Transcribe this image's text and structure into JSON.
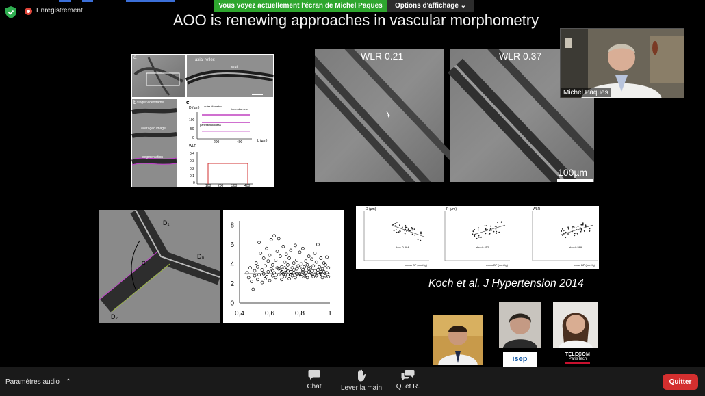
{
  "meeting": {
    "recording_label": "Enregistrement",
    "share_banner": "Vous voyez actuellement l'écran de Michel Paques",
    "view_options": "Options d'affichage",
    "quit_label": "Quitter",
    "audio_settings_label": "Paramètres audio",
    "toolbar": [
      {
        "label": "Chat",
        "icon": "chat-icon"
      },
      {
        "label": "Lever la main",
        "icon": "raise-hand-icon"
      },
      {
        "label": "Q. et R.",
        "icon": "qa-icon"
      }
    ],
    "participant_name": "Michel Paques",
    "colors": {
      "banner": "#2ea62e",
      "quit": "#d42f2f",
      "shield": "#2fae50",
      "record": "#e0453a"
    }
  },
  "slide": {
    "title": "AOO is renewing approaches in vascular morphometry",
    "wlr_left": "WLR 0.21",
    "wlr_right": "WLR 0.37",
    "scale_bar": "100µm",
    "citation": "Koch et al. J Hypertension 2014",
    "fig_a": {
      "panel_a": "a",
      "panel_b": "b",
      "panel_c": "c",
      "axial_reflex": "axial reflex",
      "wall": "wall",
      "single_videoframe": "single videoframe",
      "averaged_image": "averaged image",
      "segmentation": "segmentation",
      "d_axis": "D (µm)",
      "outer_diameter": "outer diameter",
      "inner_diameter": "inner diameter",
      "parietal_thickness": "parietal thickness",
      "l_axis": "L (µm)",
      "wlr_axis": "WLR",
      "y_ticks_top": [
        "100",
        "50",
        "0"
      ],
      "x_ticks_top": [
        "200",
        "400"
      ],
      "y_ticks_bottom": [
        "0.4",
        "0.3",
        "0.2",
        "0.1",
        "0"
      ],
      "x_ticks_bottom": [
        "100",
        "200",
        "300",
        "400"
      ]
    },
    "bifurcation": {
      "d1": "D₁",
      "d0": "D₀",
      "d2": "D₂",
      "alpha": "α"
    },
    "koch_panels": [
      {
        "ylabel": "D (µm)",
        "rho": "rho=-0.384",
        "xlabel": "mean BP (mmHg)"
      },
      {
        "ylabel": "P (µm)",
        "rho": "rho=0.452",
        "xlabel": "mean BP (mmHg)"
      },
      {
        "ylabel": "WLR",
        "rho": "rho=0.589",
        "xlabel": "mean BP (mmHg)"
      }
    ],
    "logos": {
      "isep": "isep",
      "telecom_top": "TELECOM",
      "telecom_bottom": "ParisTech"
    }
  },
  "chart_data": {
    "type": "scatter",
    "title": "",
    "xlabel": "",
    "ylabel": "",
    "xlim": [
      0.4,
      1
    ],
    "ylim": [
      0,
      8
    ],
    "x_ticks": [
      "0,4",
      "0,6",
      "0,8",
      "1"
    ],
    "y_ticks": [
      "0",
      "2",
      "4",
      "6",
      "8"
    ],
    "reference_line_y": 3,
    "points": [
      [
        0.45,
        3.1
      ],
      [
        0.46,
        2.6
      ],
      [
        0.47,
        3.6
      ],
      [
        0.48,
        2.2
      ],
      [
        0.49,
        1.4
      ],
      [
        0.5,
        3.3
      ],
      [
        0.5,
        2.8
      ],
      [
        0.51,
        4.1
      ],
      [
        0.52,
        2.4
      ],
      [
        0.52,
        3.7
      ],
      [
        0.53,
        6.2
      ],
      [
        0.53,
        2.9
      ],
      [
        0.54,
        5.1
      ],
      [
        0.55,
        3.4
      ],
      [
        0.55,
        2.1
      ],
      [
        0.56,
        4.6
      ],
      [
        0.56,
        3.0
      ],
      [
        0.57,
        2.5
      ],
      [
        0.57,
        3.8
      ],
      [
        0.58,
        5.6
      ],
      [
        0.58,
        2.7
      ],
      [
        0.59,
        4.3
      ],
      [
        0.59,
        3.2
      ],
      [
        0.6,
        2.3
      ],
      [
        0.6,
        4.9
      ],
      [
        0.61,
        3.5
      ],
      [
        0.61,
        6.5
      ],
      [
        0.62,
        2.8
      ],
      [
        0.62,
        3.9
      ],
      [
        0.63,
        6.9
      ],
      [
        0.63,
        3.1
      ],
      [
        0.64,
        4.4
      ],
      [
        0.64,
        2.6
      ],
      [
        0.65,
        3.6
      ],
      [
        0.65,
        5.3
      ],
      [
        0.66,
        6.6
      ],
      [
        0.66,
        2.9
      ],
      [
        0.67,
        3.3
      ],
      [
        0.67,
        4.8
      ],
      [
        0.68,
        2.4
      ],
      [
        0.68,
        3.7
      ],
      [
        0.69,
        5.8
      ],
      [
        0.69,
        3.0
      ],
      [
        0.7,
        4.2
      ],
      [
        0.7,
        2.7
      ],
      [
        0.71,
        3.4
      ],
      [
        0.71,
        5.0
      ],
      [
        0.72,
        2.9
      ],
      [
        0.72,
        3.9
      ],
      [
        0.73,
        4.6
      ],
      [
        0.73,
        2.5
      ],
      [
        0.74,
        3.2
      ],
      [
        0.74,
        5.4
      ],
      [
        0.75,
        3.6
      ],
      [
        0.75,
        2.8
      ],
      [
        0.76,
        4.1
      ],
      [
        0.76,
        3.1
      ],
      [
        0.77,
        5.9
      ],
      [
        0.77,
        2.6
      ],
      [
        0.78,
        3.5
      ],
      [
        0.78,
        4.4
      ],
      [
        0.79,
        2.9
      ],
      [
        0.79,
        3.8
      ],
      [
        0.8,
        5.2
      ],
      [
        0.8,
        3.0
      ],
      [
        0.81,
        2.7
      ],
      [
        0.81,
        4.0
      ],
      [
        0.82,
        3.4
      ],
      [
        0.82,
        5.6
      ],
      [
        0.83,
        2.8
      ],
      [
        0.83,
        3.7
      ],
      [
        0.84,
        4.3
      ],
      [
        0.84,
        3.1
      ],
      [
        0.85,
        2.6
      ],
      [
        0.85,
        3.9
      ],
      [
        0.86,
        4.8
      ],
      [
        0.86,
        3.2
      ],
      [
        0.87,
        2.9
      ],
      [
        0.87,
        3.6
      ],
      [
        0.88,
        4.5
      ],
      [
        0.88,
        3.0
      ],
      [
        0.89,
        2.7
      ],
      [
        0.89,
        3.8
      ],
      [
        0.9,
        5.1
      ],
      [
        0.9,
        3.3
      ],
      [
        0.91,
        2.8
      ],
      [
        0.91,
        4.2
      ],
      [
        0.92,
        6.0
      ],
      [
        0.92,
        3.1
      ],
      [
        0.93,
        2.9
      ],
      [
        0.93,
        3.7
      ],
      [
        0.94,
        4.6
      ],
      [
        0.94,
        3.0
      ],
      [
        0.95,
        2.6
      ],
      [
        0.95,
        3.5
      ],
      [
        0.96,
        4.1
      ],
      [
        0.96,
        3.2
      ],
      [
        0.97,
        2.8
      ],
      [
        0.97,
        3.9
      ],
      [
        0.98,
        4.7
      ],
      [
        0.98,
        3.1
      ],
      [
        0.99,
        2.7
      ],
      [
        0.99,
        3.6
      ],
      [
        0.7,
        3.1
      ],
      [
        0.72,
        3.3
      ],
      [
        0.74,
        2.9
      ],
      [
        0.76,
        3.4
      ],
      [
        0.78,
        3.0
      ],
      [
        0.8,
        3.6
      ],
      [
        0.82,
        3.2
      ],
      [
        0.84,
        2.8
      ],
      [
        0.86,
        3.5
      ],
      [
        0.88,
        3.3
      ],
      [
        0.9,
        2.9
      ],
      [
        0.92,
        3.4
      ],
      [
        0.94,
        3.2
      ],
      [
        0.66,
        3.5
      ],
      [
        0.68,
        3.2
      ],
      [
        0.7,
        3.6
      ],
      [
        0.62,
        3.3
      ]
    ]
  }
}
